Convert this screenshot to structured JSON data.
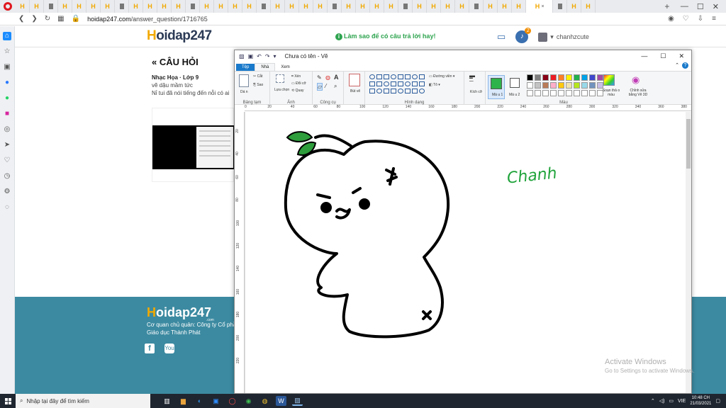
{
  "browser": {
    "tab_count": 40,
    "active_tab_glyph": "H",
    "tab_close_glyph": "×",
    "new_tab": "+",
    "url_domain": "hoidap247.com",
    "url_path": "/answer_question/1716765"
  },
  "site": {
    "logo_h": "H",
    "logo_rest": "oidap247",
    "logo_sub": ".com",
    "tip": "Làm sao để có câu trả lời hay!",
    "notification_count": "2",
    "username": "chanhzcute",
    "question_title": "« CÂU HỎI",
    "question_meta": "Nhạc Họa · Lớp 9",
    "question_line1": "vẽ dậu mầm tức",
    "question_line2": "Nỉ tui đã nói tiếng đến nỗi có ai",
    "footer_line1": "Cơ quan chủ quản: Công ty Cổ phần",
    "footer_line2": "Giáo dục Thành Phát",
    "facebook_glyph": "f",
    "youtube_glyph": "You"
  },
  "paint": {
    "title": "Chưa có tên - Vẽ",
    "tabs": [
      "Tệp",
      "Nhà",
      "Xem"
    ],
    "groups": {
      "clipboard": "Bảng tạm",
      "image": "Ảnh",
      "tools": "Công cụ",
      "shapes": "Hình dạng",
      "colors": "Màu"
    },
    "clipboard_paste": "Dá n",
    "clipboard_cut": "Cắt",
    "clipboard_copy": "Sao",
    "image_select": "Lựa chọn",
    "image_crop": "Xén",
    "image_resize": "Đổi cỡ",
    "image_rotate": "Quay",
    "brush": "Bút vẽ",
    "outline": "Đường viền",
    "fill": "Tô",
    "size": "Kích cỡ",
    "color1": "Mà u 1",
    "color2": "Mà u 2",
    "edit_colors": "Soạn thả o màu",
    "edit_3d": "Chỉnh sửa bằng Vẽ 3D",
    "ruler_h": [
      "0",
      "20",
      "40",
      "60",
      "80",
      "100",
      "120",
      "140",
      "160",
      "180",
      "200",
      "220",
      "240",
      "260",
      "280",
      "300",
      "320",
      "340",
      "360",
      "380"
    ],
    "ruler_v": [
      "20",
      "40",
      "60",
      "80",
      "100",
      "120",
      "140",
      "160",
      "180",
      "200",
      "220"
    ],
    "canvas_text": "Chanh",
    "palette": [
      "#000000",
      "#7f7f7f",
      "#880015",
      "#ed1c24",
      "#ff7f27",
      "#fff200",
      "#22b14c",
      "#00a2e8",
      "#3f48cc",
      "#a349a4",
      "#ffffff",
      "#c3c3c3",
      "#b97a57",
      "#ffaec9",
      "#ffc90e",
      "#efe4b0",
      "#b5e61d",
      "#99d9ea",
      "#7092be",
      "#c8bfe7"
    ],
    "color1_value": "#2eb34a"
  },
  "windows": {
    "activation_line1": "Activate Windows",
    "activation_line2": "Go to Settings to activate Windows.",
    "search_placeholder": "Nhập tại đây để tìm kiếm",
    "tray_lang": "VIE",
    "time": "10:48 CH",
    "date": "21/03/2021"
  }
}
